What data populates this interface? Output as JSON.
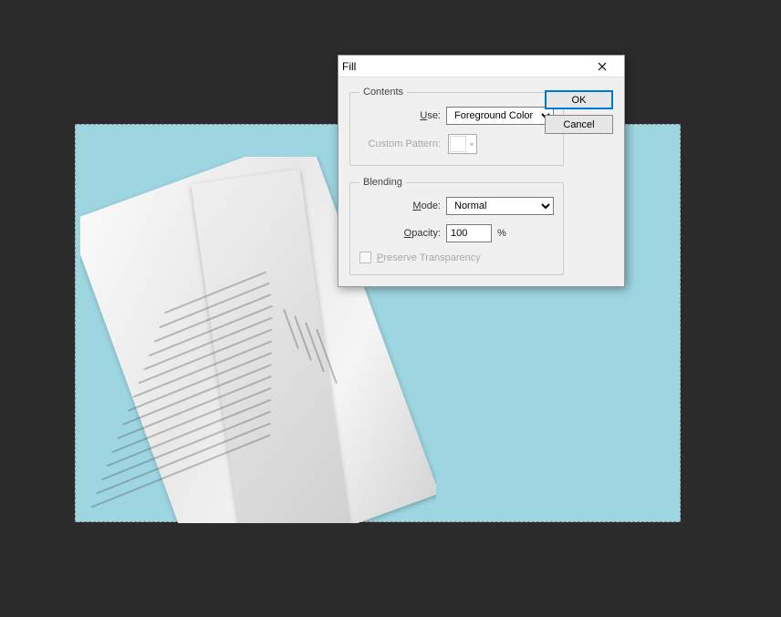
{
  "dialog": {
    "title": "Fill",
    "sections": {
      "contents": {
        "legend": "Contents",
        "use_label": "Use:",
        "use_value": "Foreground Color",
        "pattern_label": "Custom Pattern:"
      },
      "blending": {
        "legend": "Blending",
        "mode_label": "Mode:",
        "mode_value": "Normal",
        "opacity_label": "Opacity:",
        "opacity_value": "100",
        "opacity_unit": "%",
        "preserve_label": "Preserve Transparency"
      }
    },
    "buttons": {
      "ok": "OK",
      "cancel": "Cancel"
    }
  }
}
